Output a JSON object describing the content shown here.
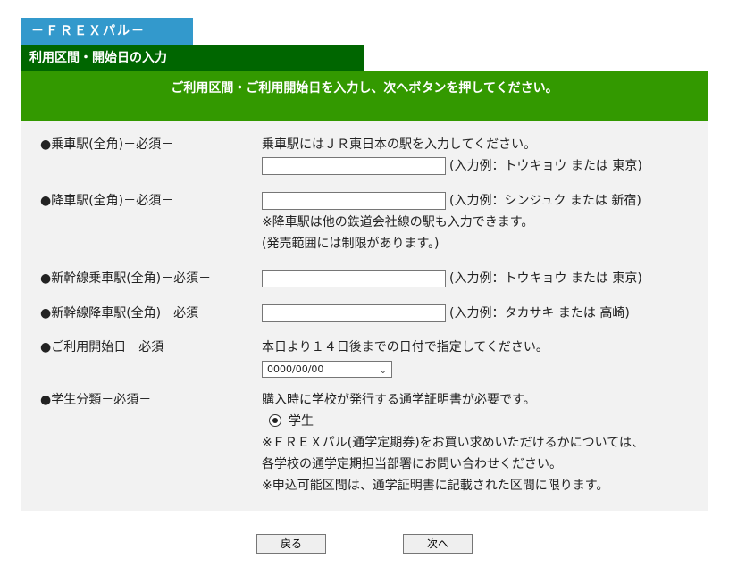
{
  "header": {
    "tab_title": "－ＦＲＥＸパル－",
    "section_title": "利用区間・開始日の入力",
    "instruction": "ご利用区間・ご利用開始日を入力し、次へボタンを押してください。"
  },
  "form": {
    "boarding": {
      "label": "●乗車駅(全角)－必須－",
      "note": "乗車駅にはＪＲ東日本の駅を入力してください。",
      "value": "",
      "example": "(入力例：トウキョウ または 東京)"
    },
    "alighting": {
      "label": "●降車駅(全角)－必須－",
      "value": "",
      "example": "(入力例：シンジュク または 新宿)",
      "note1": "※降車駅は他の鉄道会社線の駅も入力できます。",
      "note2": "(発売範囲には制限があります。)"
    },
    "shinkansen_boarding": {
      "label": "●新幹線乗車駅(全角)－必須－",
      "value": "",
      "example": "(入力例：トウキョウ または 東京)"
    },
    "shinkansen_alighting": {
      "label": "●新幹線降車駅(全角)－必須－",
      "value": "",
      "example": "(入力例：タカサキ または 高崎)"
    },
    "start_date": {
      "label": "●ご利用開始日－必須－",
      "note": "本日より１４日後までの日付で指定してください。",
      "selected": "0000/00/00"
    },
    "student": {
      "label": "●学生分類－必須－",
      "note": "購入時に学校が発行する通学証明書が必要です。",
      "option": "学生",
      "note2": "※ＦＲＥＸパル(通学定期券)をお買い求めいただけるかについては、",
      "note3": "各学校の通学定期担当部署にお問い合わせください。",
      "note4": "※申込可能区間は、通学証明書に記載された区間に限ります。"
    }
  },
  "buttons": {
    "back": "戻る",
    "next": "次へ"
  }
}
